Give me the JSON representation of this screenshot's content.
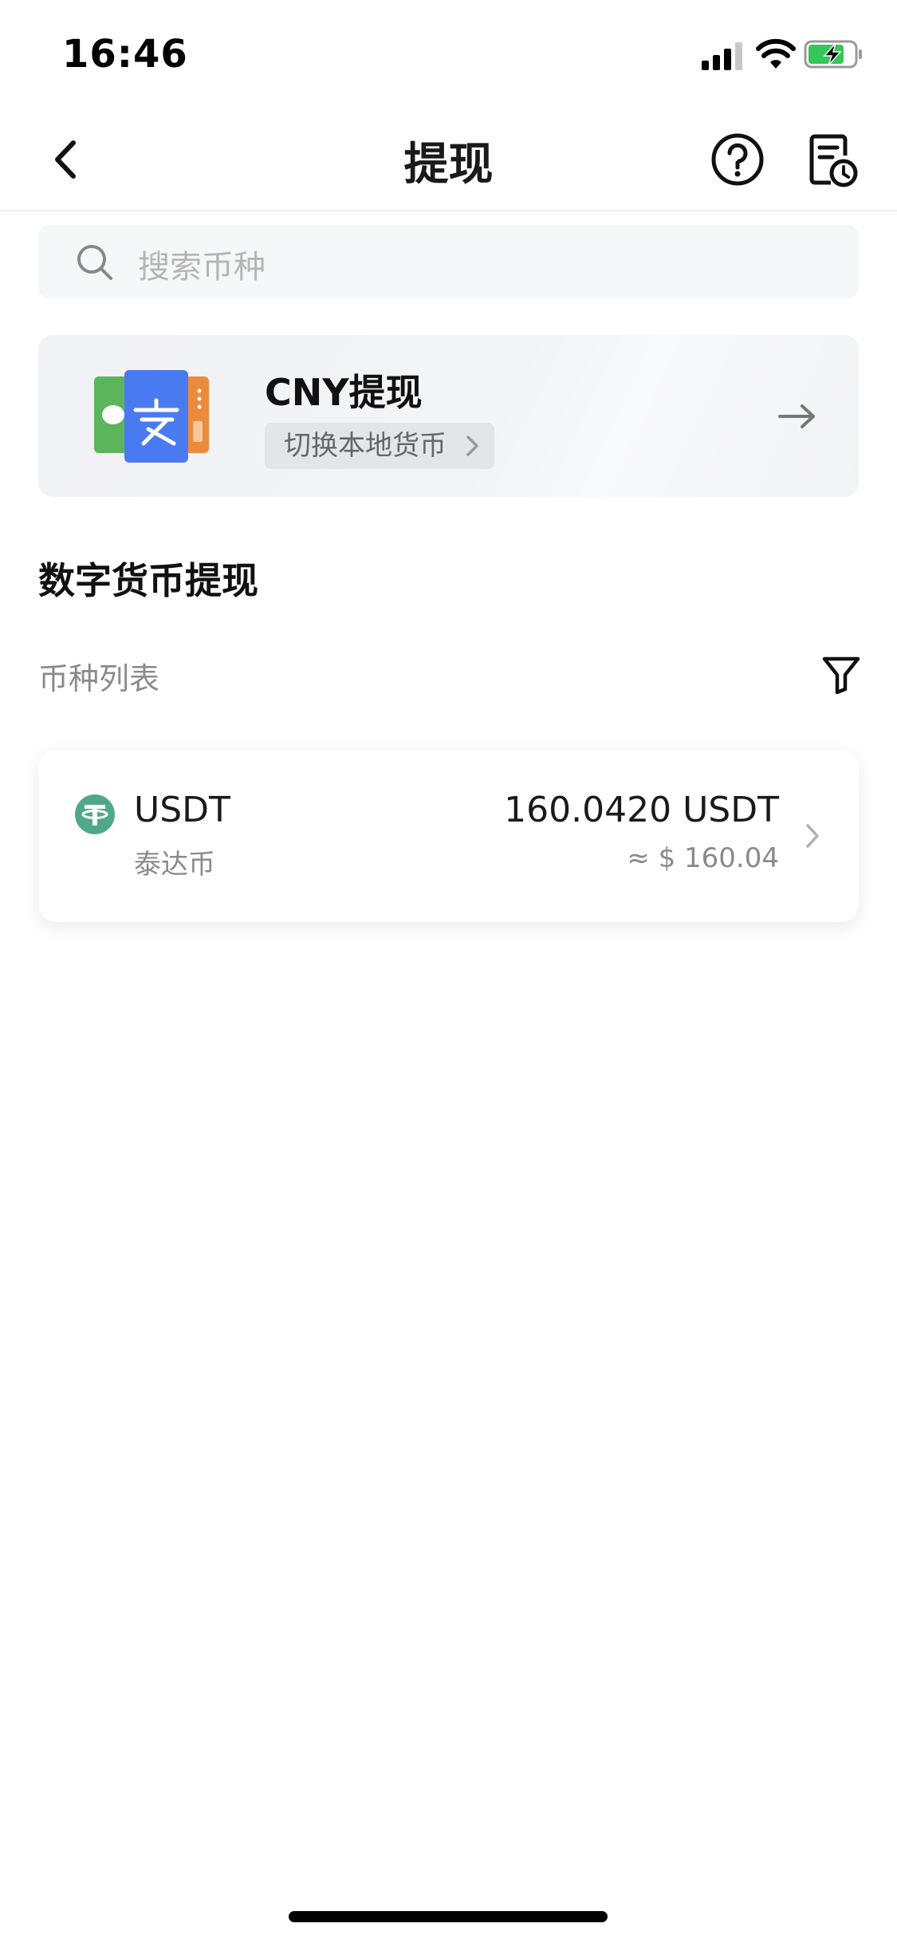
{
  "status_bar": {
    "time": "16:46"
  },
  "nav": {
    "title": "提现"
  },
  "search": {
    "placeholder": "搜索币种"
  },
  "cny_card": {
    "title": "CNY提现",
    "switch_label": "切换本地货币"
  },
  "digital_section": {
    "title": "数字货币提现",
    "list_label": "币种列表"
  },
  "coins": [
    {
      "symbol": "USDT",
      "name": "泰达币",
      "amount": "160.0420 USDT",
      "usd_value": "≈ $ 160.04",
      "icon_color": "#50a88a"
    }
  ],
  "colors": {
    "card_bg": "#f1f2f5",
    "tether_green": "#50a88a",
    "pill_bg": "#e4e5e8"
  },
  "icons": [
    "back-icon",
    "help-icon",
    "record-icon",
    "search-icon",
    "payment-logos-icon",
    "chevron-right-icon",
    "arrow-right-icon",
    "filter-icon",
    "tether-icon"
  ]
}
